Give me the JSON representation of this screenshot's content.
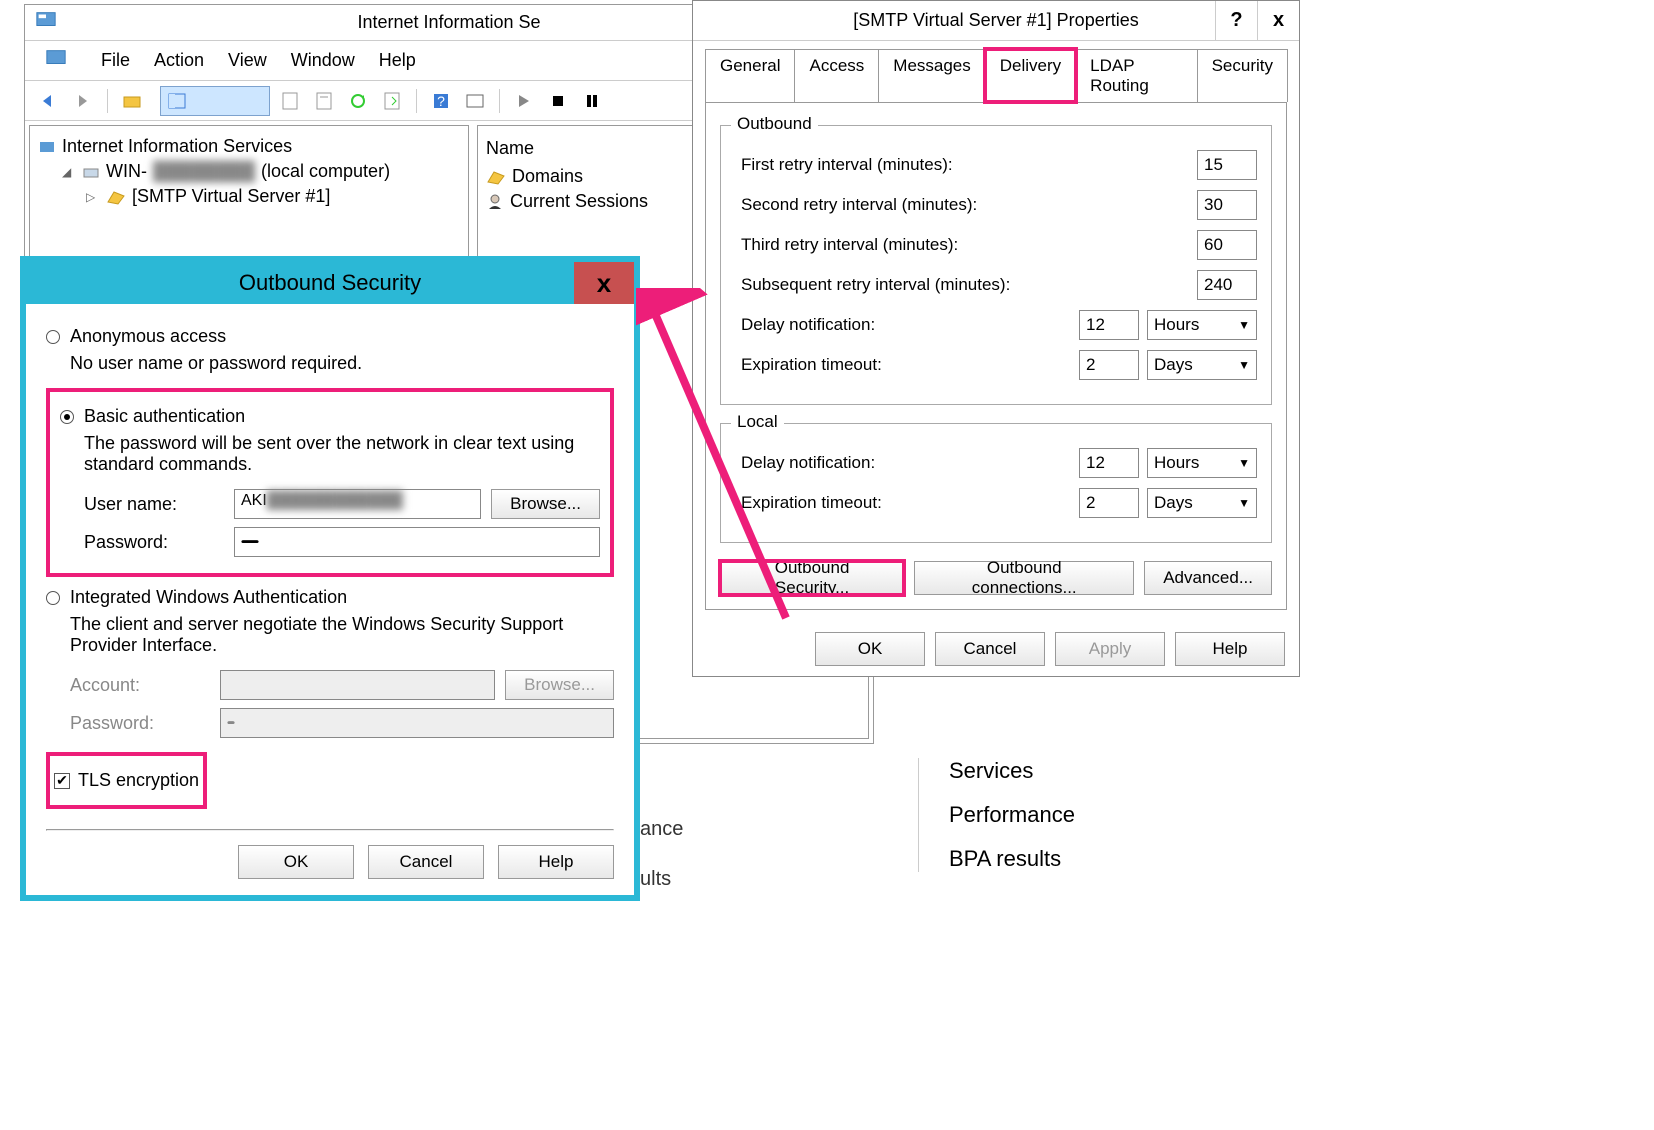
{
  "iis": {
    "title": "Internet Information Se",
    "menus": [
      "File",
      "Action",
      "View",
      "Window",
      "Help"
    ],
    "tree": {
      "root": "Internet Information Services",
      "computer": "WIN-",
      "computer_suffix": " (local computer)",
      "server": "[SMTP Virtual Server #1]"
    },
    "list_header": "Name",
    "list_items": [
      "Domains",
      "Current Sessions"
    ]
  },
  "props": {
    "title": "[SMTP Virtual Server #1] Properties",
    "tabs": [
      "General",
      "Access",
      "Messages",
      "Delivery",
      "LDAP Routing",
      "Security"
    ],
    "outbound": {
      "title": "Outbound",
      "first_retry_label": "First retry interval (minutes):",
      "first_retry": "15",
      "second_retry_label": "Second retry interval (minutes):",
      "second_retry": "30",
      "third_retry_label": "Third retry interval (minutes):",
      "third_retry": "60",
      "subsequent_label": "Subsequent retry interval (minutes):",
      "subsequent": "240",
      "delay_label": "Delay notification:",
      "delay": "12",
      "delay_unit": "Hours",
      "expiration_label": "Expiration timeout:",
      "expiration": "2",
      "expiration_unit": "Days"
    },
    "local": {
      "title": "Local",
      "delay_label": "Delay notification:",
      "delay": "12",
      "delay_unit": "Hours",
      "expiration_label": "Expiration timeout:",
      "expiration": "2",
      "expiration_unit": "Days"
    },
    "buttons": {
      "outbound_security": "Outbound Security...",
      "outbound_connections": "Outbound connections...",
      "advanced": "Advanced..."
    },
    "dialog_buttons": {
      "ok": "OK",
      "cancel": "Cancel",
      "apply": "Apply",
      "help": "Help"
    }
  },
  "outsec": {
    "title": "Outbound Security",
    "close": "x",
    "anon": {
      "label": "Anonymous access",
      "desc": "No user name or password required."
    },
    "basic": {
      "label": "Basic authentication",
      "desc": "The password will be sent over the network in clear text using standard commands.",
      "user_label": "User name:",
      "user_value": "AKI",
      "pass_label": "Password:",
      "pass_value": "••••••••••••••••••••••••••••••",
      "browse": "Browse..."
    },
    "iwa": {
      "label": "Integrated Windows Authentication",
      "desc": "The client and server negotiate the Windows Security Support Provider Interface.",
      "account_label": "Account:",
      "pass_label": "Password:",
      "pass_value": "••••••••••",
      "browse": "Browse..."
    },
    "tls": "TLS encryption",
    "buttons": {
      "ok": "OK",
      "cancel": "Cancel",
      "help": "Help"
    }
  },
  "side": {
    "services": "Services",
    "perf": "Performance",
    "bpa": "BPA results"
  },
  "leftovers": {
    "ance": "ance",
    "ults": "ults"
  }
}
